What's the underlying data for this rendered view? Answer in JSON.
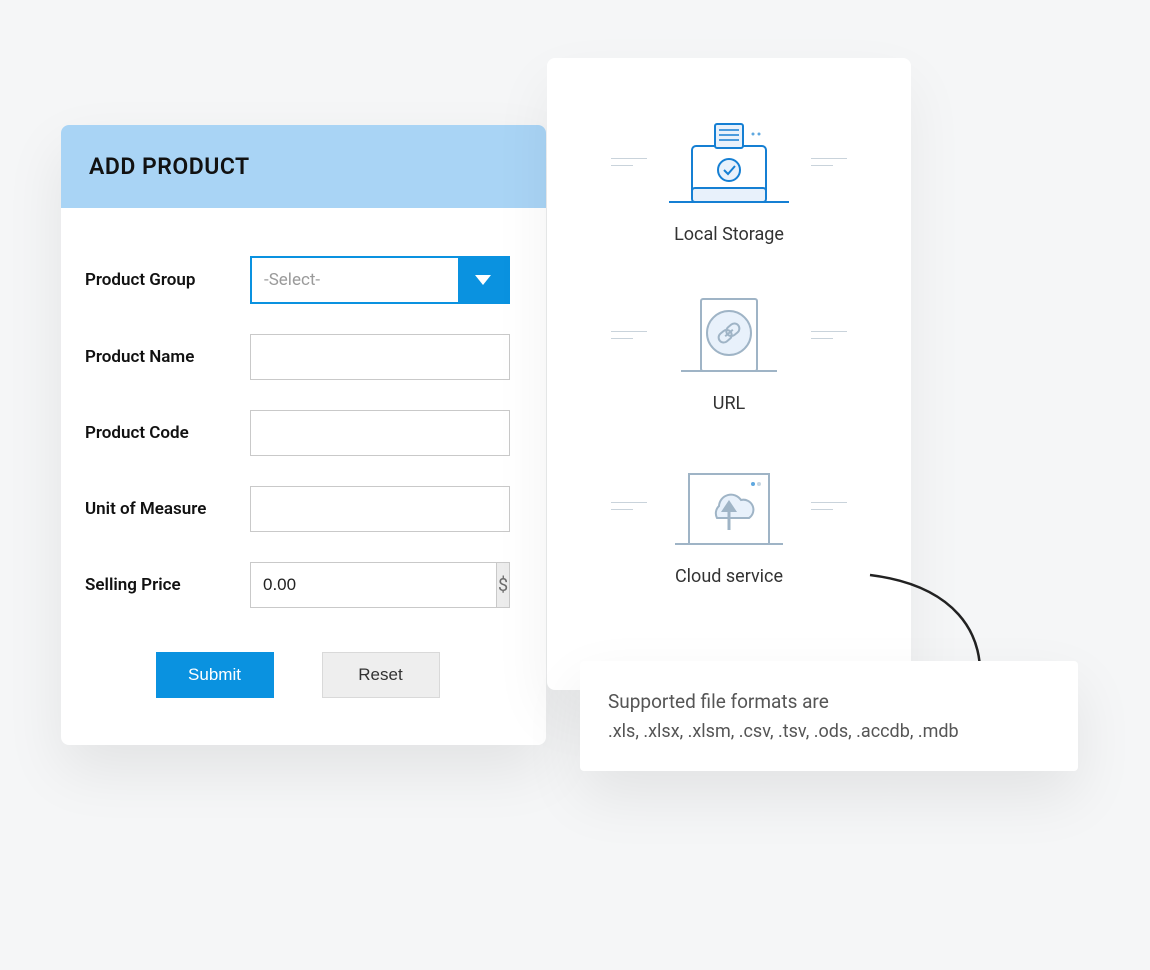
{
  "form": {
    "title": "ADD PRODUCT",
    "fields": {
      "product_group": {
        "label": "Product Group",
        "placeholder": "-Select-"
      },
      "product_name": {
        "label": "Product Name"
      },
      "product_code": {
        "label": "Product Code"
      },
      "unit_of_measure": {
        "label": "Unit of Measure"
      },
      "selling_price": {
        "label": "Selling Price",
        "value": "0.00",
        "currency": "$"
      }
    },
    "buttons": {
      "submit": "Submit",
      "reset": "Reset"
    }
  },
  "import": {
    "sources": [
      {
        "id": "local",
        "label": "Local Storage"
      },
      {
        "id": "url",
        "label": "URL"
      },
      {
        "id": "cloud",
        "label": "Cloud service"
      }
    ]
  },
  "formats": {
    "heading": "Supported file formats are",
    "list": ".xls, .xlsx, .xlsm, .csv, .tsv, .ods, .accdb, .mdb"
  },
  "colors": {
    "accent": "#0a92e0",
    "header_bg": "#a9d4f5"
  }
}
